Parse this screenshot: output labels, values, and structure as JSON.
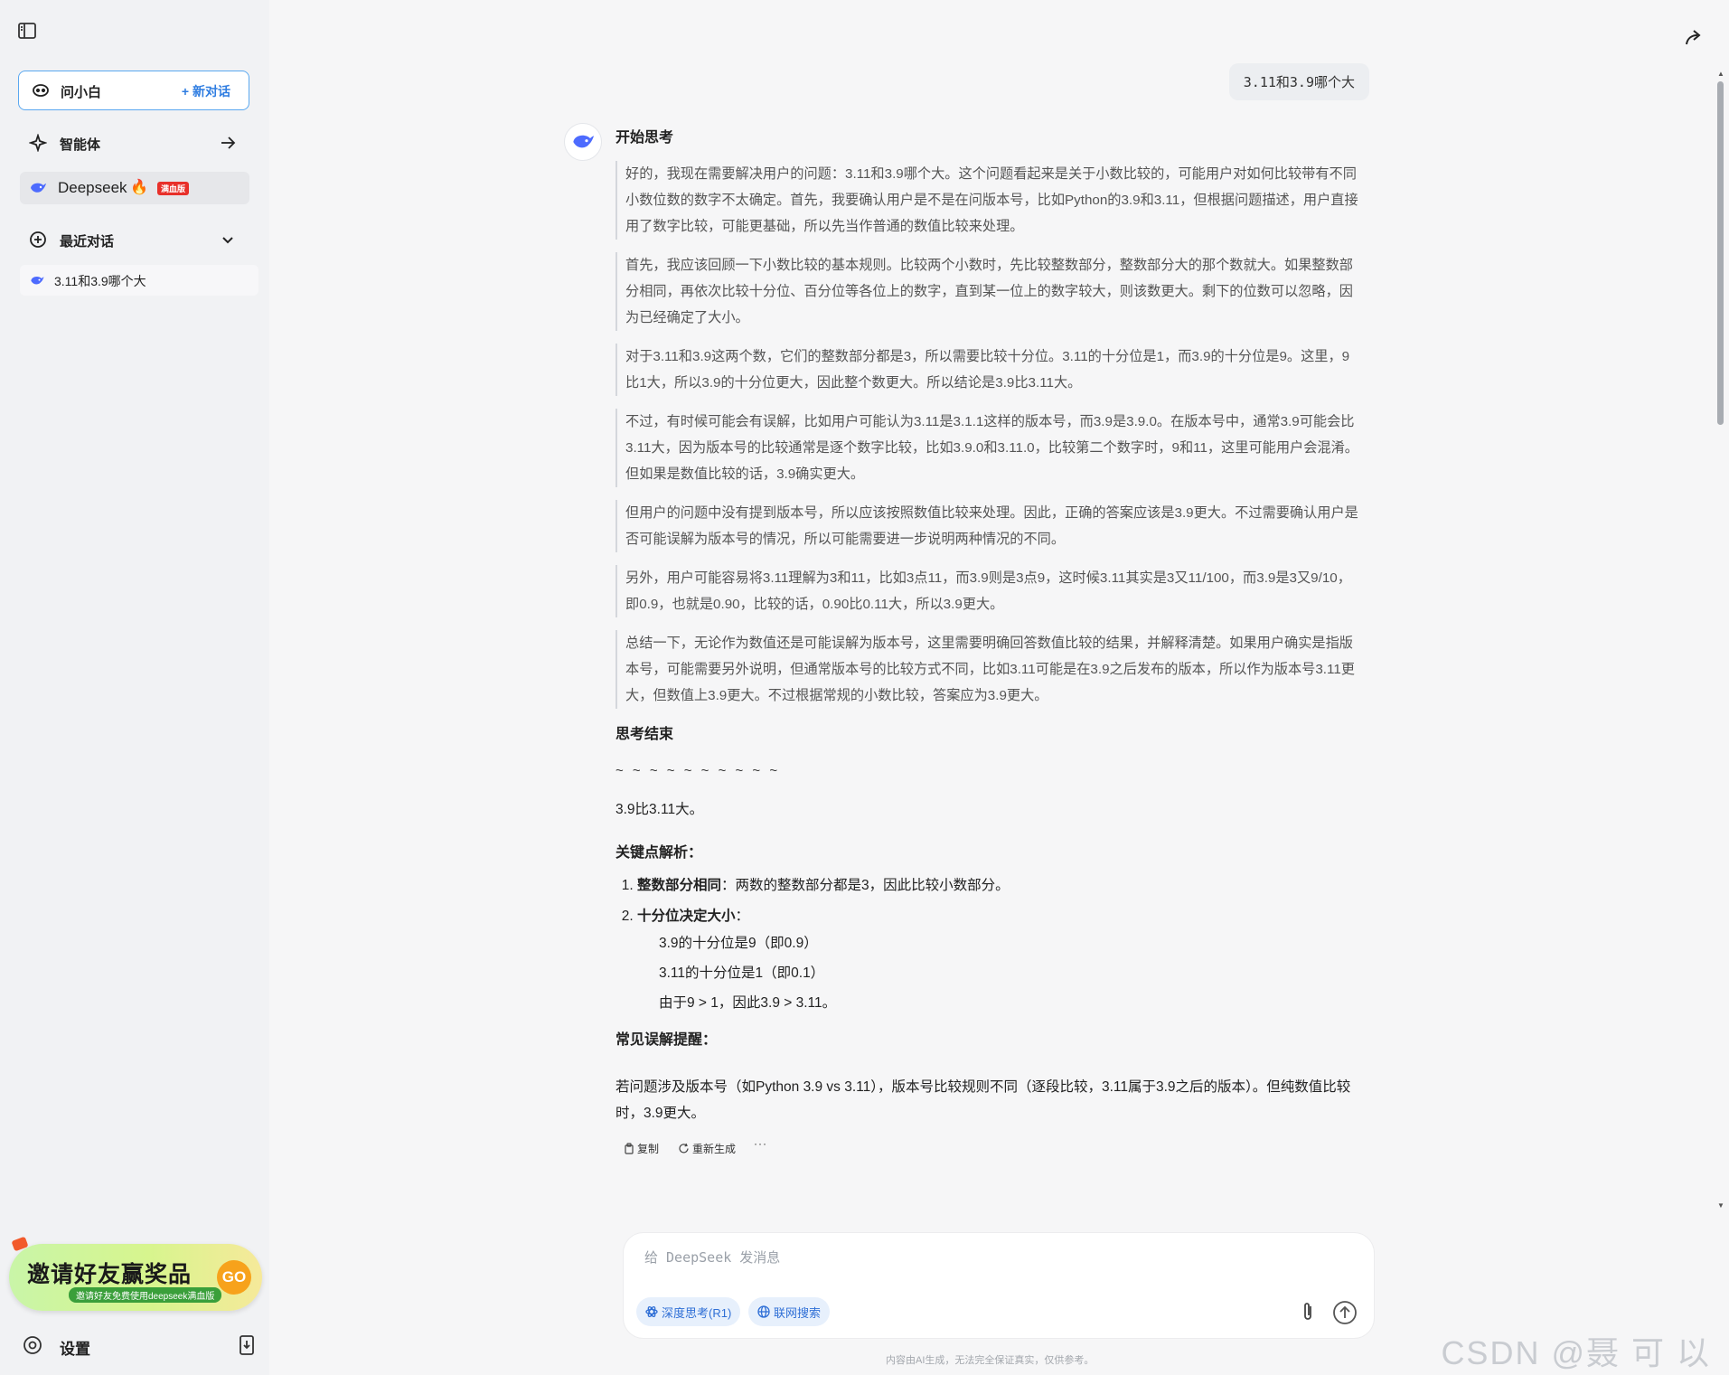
{
  "sidebar": {
    "ask_label": "问小白",
    "new_chat_label": "+ 新对话",
    "agents_label": "智能体",
    "deepseek_label": "Deepseek",
    "deepseek_badge": "满血版",
    "recent_label": "最近对话",
    "recent_items": [
      {
        "label": "3.11和3.9哪个大"
      }
    ],
    "promo": {
      "title": "邀请好友赢奖品",
      "subtitle": "邀请好友免费使用deepseek满血版",
      "go_label": "GO"
    },
    "settings_label": "设置"
  },
  "chat": {
    "user_message": "3.11和3.9哪个大",
    "think_start_label": "开始思考",
    "think_paragraphs": [
      "好的，我现在需要解决用户的问题：3.11和3.9哪个大。这个问题看起来是关于小数比较的，可能用户对如何比较带有不同小数位数的数字不太确定。首先，我要确认用户是不是在问版本号，比如Python的3.9和3.11，但根据问题描述，用户直接用了数字比较，可能更基础，所以先当作普通的数值比较来处理。",
      "首先，我应该回顾一下小数比较的基本规则。比较两个小数时，先比较整数部分，整数部分大的那个数就大。如果整数部分相同，再依次比较十分位、百分位等各位上的数字，直到某一位上的数字较大，则该数更大。剩下的位数可以忽略，因为已经确定了大小。",
      "对于3.11和3.9这两个数，它们的整数部分都是3，所以需要比较十分位。3.11的十分位是1，而3.9的十分位是9。这里，9比1大，所以3.9的十分位更大，因此整个数更大。所以结论是3.9比3.11大。",
      "不过，有时候可能会有误解，比如用户可能认为3.11是3.1.1这样的版本号，而3.9是3.9.0。在版本号中，通常3.9可能会比3.11大，因为版本号的比较通常是逐个数字比较，比如3.9.0和3.11.0，比较第二个数字时，9和11，这里可能用户会混淆。但如果是数值比较的话，3.9确实更大。",
      "但用户的问题中没有提到版本号，所以应该按照数值比较来处理。因此，正确的答案应该是3.9更大。不过需要确认用户是否可能误解为版本号的情况，所以可能需要进一步说明两种情况的不同。",
      "另外，用户可能容易将3.11理解为3和11，比如3点11，而3.9则是3点9，这时候3.11其实是3又11/100，而3.9是3又9/10，即0.9，也就是0.90，比较的话，0.90比0.11大，所以3.9更大。",
      "总结一下，无论作为数值还是可能误解为版本号，这里需要明确回答数值比较的结果，并解释清楚。如果用户确实是指版本号，可能需要另外说明，但通常版本号的比较方式不同，比如3.11可能是在3.9之后发布的版本，所以作为版本号3.11更大，但数值上3.9更大。不过根据常规的小数比较，答案应为3.9更大。"
    ],
    "think_end_label": "思考结束",
    "separator": "~ ~ ~ ~ ~ ~ ~ ~ ~ ~",
    "answer": "3.9比3.11大。",
    "key_points_title": "关键点解析：",
    "key_points": [
      {
        "title": "整数部分相同",
        "text": "：两数的整数部分都是3，因此比较小数部分。"
      },
      {
        "title": "十分位决定大小",
        "text": "："
      }
    ],
    "tenths_lines": [
      "3.9的十分位是9（即0.9）",
      "3.11的十分位是1（即0.1）",
      "由于9 > 1，因此3.9 > 3.11。"
    ],
    "misconception_title": "常见误解提醒：",
    "misconception_text": "若问题涉及版本号（如Python 3.9 vs 3.11），版本号比较规则不同（逐段比较，3.11属于3.9之后的版本）。但纯数值比较时，3.9更大。",
    "actions": {
      "copy": "复制",
      "regenerate": "重新生成",
      "more": "···"
    }
  },
  "input": {
    "placeholder": "给 DeepSeek 发消息",
    "deep_think_label": "深度思考(R1)",
    "web_search_label": "联网搜索"
  },
  "footer": {
    "disclaimer": "内容由AI生成，无法完全保证真实，仅供参考。",
    "watermark": "CSDN @聂 可 以"
  },
  "colors": {
    "accent": "#2f7de1",
    "deepseek_blue": "#4d6bfe",
    "badge_red": "#e8302a"
  }
}
